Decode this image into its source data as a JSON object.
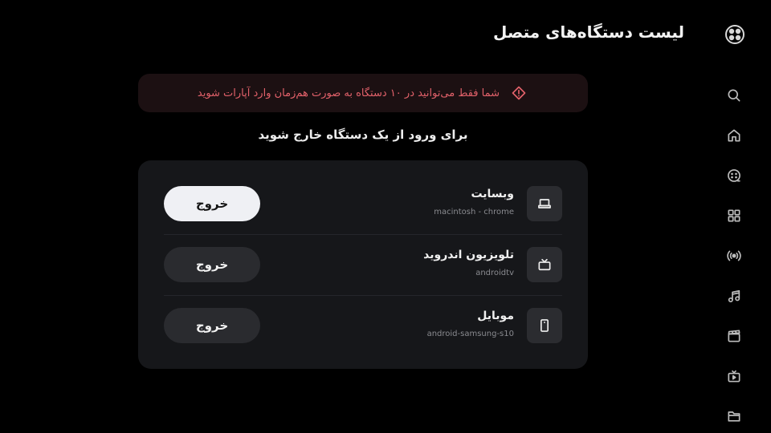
{
  "header": {
    "title": "لیست دستگاه‌های متصل"
  },
  "sidebar": {
    "items": [
      {
        "icon": "search-icon"
      },
      {
        "icon": "home-icon"
      },
      {
        "icon": "film-reel-icon"
      },
      {
        "icon": "grid-icon"
      },
      {
        "icon": "broadcast-icon"
      },
      {
        "icon": "music-icon"
      },
      {
        "icon": "clapperboard-icon"
      },
      {
        "icon": "tv-play-icon"
      },
      {
        "icon": "folder-icon"
      }
    ]
  },
  "warning": {
    "text": "شما فقط می‌توانید در ۱۰ دستگاه به صورت هم‌زمان وارد آپارات شوید",
    "color": "#e2616a"
  },
  "subtitle": "برای ورود از یک دستگاه خارج شوید",
  "devices": [
    {
      "name": "وبسایت",
      "detail": "macintosh - chrome",
      "icon": "laptop-icon",
      "button": "خروج"
    },
    {
      "name": "تلویزیون اندروید",
      "detail": "androidtv",
      "icon": "tv-icon",
      "button": "خروج"
    },
    {
      "name": "موبایل",
      "detail": "android-samsung-s10",
      "icon": "mobile-icon",
      "button": "خروج"
    }
  ]
}
